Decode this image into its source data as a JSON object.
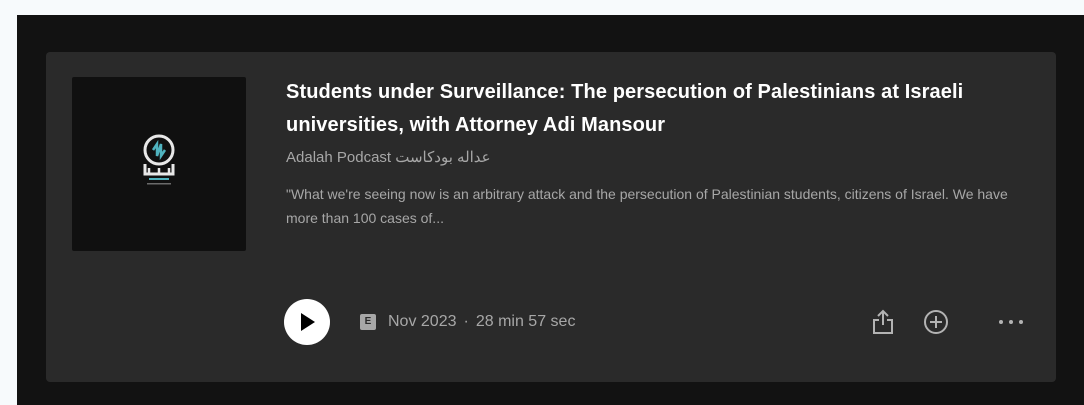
{
  "episode": {
    "title": "Students under Surveillance: The persecution of Palestinians at Israeli universities, with Attorney Adi Mansour",
    "publisher": "Adalah Podcast عداله بودكاست",
    "description": "\"What we're seeing now is an arbitrary attack and the persecution of Palestinian students, citizens of Israel. We have more than 100 cases of...",
    "explicit_badge": "E",
    "date": "Nov 2023",
    "separator": "·",
    "duration": "28 min 57 sec"
  },
  "icons": {
    "play": "play-icon",
    "share": "share-icon",
    "add": "plus-circle-icon",
    "more": "more-horizontal-icon",
    "cover_logo": "adalah-logo"
  },
  "colors": {
    "card_bg": "#2a2a2a",
    "page_bg": "#121212",
    "title": "#ffffff",
    "muted_text": "#a7a7a7",
    "logo_accent": "#4fb3bf"
  }
}
